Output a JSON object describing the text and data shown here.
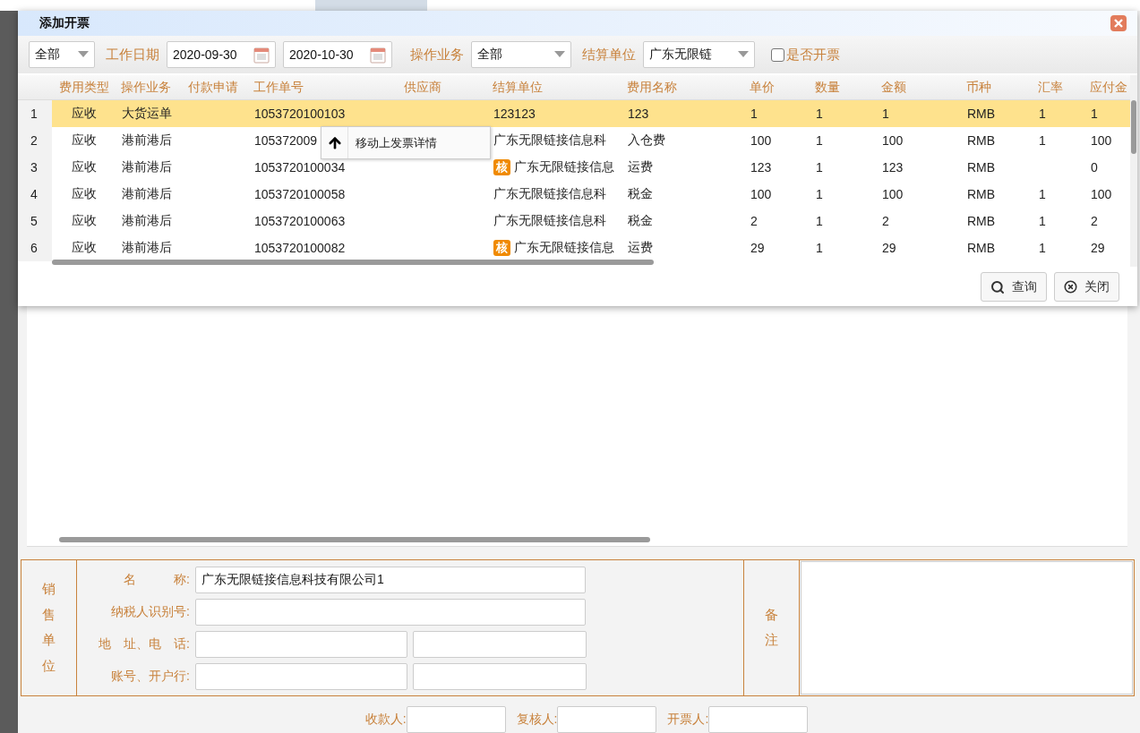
{
  "dialog": {
    "title": "添加开票",
    "filters": {
      "scope": "全部",
      "date_label": "工作日期",
      "date_from": "2020-09-30",
      "date_to": "2020-10-30",
      "operation_label": "操作业务",
      "operation": "全部",
      "settle_label": "结算单位",
      "settle": "广东无限链",
      "invoiced_label": "是否开票",
      "invoiced_checked": false
    },
    "columns": [
      {
        "label": "费用类型",
        "centered": true
      },
      {
        "label": "操作业务",
        "centered": false
      },
      {
        "label": "付款申请",
        "centered": false
      },
      {
        "label": "工作单号",
        "centered": false
      },
      {
        "label": "供应商",
        "centered": true
      },
      {
        "label": "结算单位",
        "centered": false
      },
      {
        "label": "费用名称",
        "centered": false
      },
      {
        "label": "单价",
        "centered": false
      },
      {
        "label": "数量",
        "centered": false
      },
      {
        "label": "金额",
        "centered": false
      },
      {
        "label": "币种",
        "centered": false
      },
      {
        "label": "汇率",
        "centered": false
      },
      {
        "label": "应付金",
        "centered": false
      }
    ],
    "rows": [
      {
        "no": "1",
        "selected": true,
        "fee_type": "应收",
        "operation": "大货运单",
        "work_no": "1053720100103",
        "settle_unit": "123123",
        "fee_name": "123",
        "unit_price": "1",
        "qty": "1",
        "amount": "1",
        "currency": "RMB",
        "rate": "1",
        "payable": "1"
      },
      {
        "no": "2",
        "selected": false,
        "fee_type": "应收",
        "operation": "港前港后",
        "work_no": "105372009",
        "settle_unit": "广东无限链接信息科",
        "fee_name": "入仓费",
        "unit_price": "100",
        "qty": "1",
        "amount": "100",
        "currency": "RMB",
        "rate": "1",
        "payable": "100"
      },
      {
        "no": "3",
        "selected": false,
        "fee_type": "应收",
        "operation": "港前港后",
        "work_no": "1053720100034",
        "badge": "核",
        "settle_unit": "广东无限链接信息",
        "fee_name": "运费",
        "unit_price": "123",
        "qty": "1",
        "amount": "123",
        "currency": "RMB",
        "payable": "0"
      },
      {
        "no": "4",
        "selected": false,
        "fee_type": "应收",
        "operation": "港前港后",
        "work_no": "1053720100058",
        "settle_unit": "广东无限链接信息科",
        "fee_name": "税金",
        "unit_price": "100",
        "qty": "1",
        "amount": "100",
        "currency": "RMB",
        "rate": "1",
        "payable": "100"
      },
      {
        "no": "5",
        "selected": false,
        "fee_type": "应收",
        "operation": "港前港后",
        "work_no": "1053720100063",
        "settle_unit": "广东无限链接信息科",
        "fee_name": "税金",
        "unit_price": "2",
        "qty": "1",
        "amount": "2",
        "currency": "RMB",
        "rate": "1",
        "payable": "2"
      },
      {
        "no": "6",
        "selected": false,
        "fee_type": "应收",
        "operation": "港前港后",
        "work_no": "1053720100082",
        "badge": "核",
        "settle_unit": "广东无限链接信息",
        "fee_name": "运费",
        "unit_price": "29",
        "qty": "1",
        "amount": "29",
        "currency": "RMB",
        "rate": "1",
        "payable": "29"
      }
    ],
    "context_menu": {
      "item": "移动上发票详情"
    },
    "buttons": [
      {
        "label": "查询",
        "kind": "search"
      },
      {
        "label": "关闭",
        "kind": "close"
      }
    ]
  },
  "seller": {
    "heading": "销售单位",
    "fields": [
      {
        "label": "名　　　称:",
        "kind": "single",
        "value": "广东无限链接信息科技有限公司1"
      },
      {
        "label": "纳税人识别号:",
        "kind": "single"
      },
      {
        "label": "地　址、电　话:",
        "kind": "double"
      },
      {
        "label": "账号、开户行:",
        "kind": "double"
      }
    ]
  },
  "remark": {
    "label": "备注"
  },
  "signatures": [
    "收款人:",
    "复核人:",
    "开票人:"
  ]
}
